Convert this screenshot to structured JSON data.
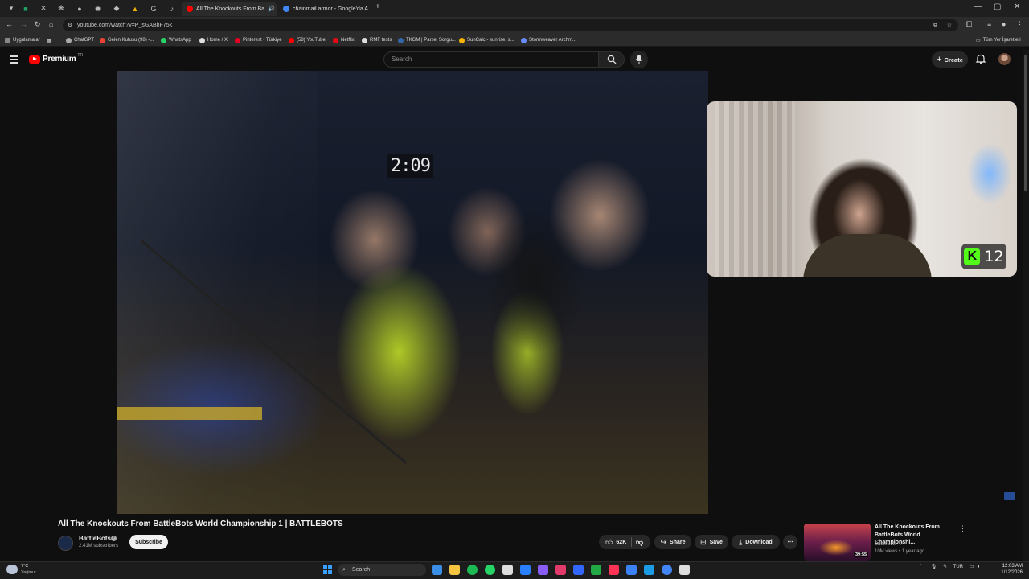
{
  "browser": {
    "tabs": [
      {
        "title": "All The Knockouts From Ba",
        "active": true,
        "favicon_color": "#ff0000"
      },
      {
        "title": "chainmail armor - Google'da A",
        "active": false,
        "favicon_color": "#4285f4"
      }
    ],
    "url": "youtube.com/watch?v=P_sGABhF75k",
    "bookmarks": [
      {
        "label": "Uygulamalar",
        "color": "#888888"
      },
      {
        "label": "ChatGPT",
        "color": "#aaaaaa"
      },
      {
        "label": "Gelen Kutusu (98) -...",
        "color": "#ea4335"
      },
      {
        "label": "WhatsApp",
        "color": "#25d366"
      },
      {
        "label": "Home / X",
        "color": "#dddddd"
      },
      {
        "label": "Pinterest - Türkiye",
        "color": "#e60023"
      },
      {
        "label": "(58) YouTube",
        "color": "#ff0000"
      },
      {
        "label": "Netflix",
        "color": "#e50914"
      },
      {
        "label": "RMF tests",
        "color": "#dddddd"
      },
      {
        "label": "TKGM | Parsel Sorgu...",
        "color": "#3366aa"
      },
      {
        "label": "SunCalc - sunrise, s...",
        "color": "#f4b400"
      },
      {
        "label": "Stormweaver Archm...",
        "color": "#6a8cff"
      }
    ],
    "bookmarks_other": "Tüm Yer İşaretleri"
  },
  "youtube": {
    "logo_text": "Premium",
    "logo_region": "TR",
    "search_placeholder": "Search",
    "create_label": "Create",
    "icons": {
      "menu": "hamburger-icon",
      "search": "search-icon",
      "mic": "mic-icon",
      "bell": "bell-icon",
      "plus": "plus-icon"
    }
  },
  "video": {
    "timer_overlay": "2:09",
    "kick_badge": "12",
    "title": "All The Knockouts From BattleBots World Championship 1 | BATTLEBOTS",
    "channel": "BattleBots",
    "subscribers": "2.41M subscribers",
    "subscribe_label": "Subscribe",
    "likes": "62K",
    "share_label": "Share",
    "save_label": "Save",
    "download_label": "Download",
    "more_label": "⋯"
  },
  "recommendation": {
    "title": "All The Knockouts From BattleBots World Championshi...",
    "channel": "BattleBots",
    "meta": "10M views • 1 year ago",
    "duration": "39:55"
  },
  "taskbar": {
    "weather_temp": "7°C",
    "weather_desc": "Yağmur",
    "search_label": "Search",
    "lang": "TUR",
    "time": "12:03 AM",
    "date": "1/12/2026",
    "app_colors": [
      "#3a8ee6",
      "#f5c542",
      "#1db954",
      "#25d366",
      "#dddddd",
      "#2a7fff",
      "#8a5cf6",
      "#e23a6a",
      "#3366ff",
      "#22aa44",
      "#ff3355",
      "#3b82f6",
      "#1b9ce5",
      "#4285f4",
      "#dddddd"
    ]
  }
}
